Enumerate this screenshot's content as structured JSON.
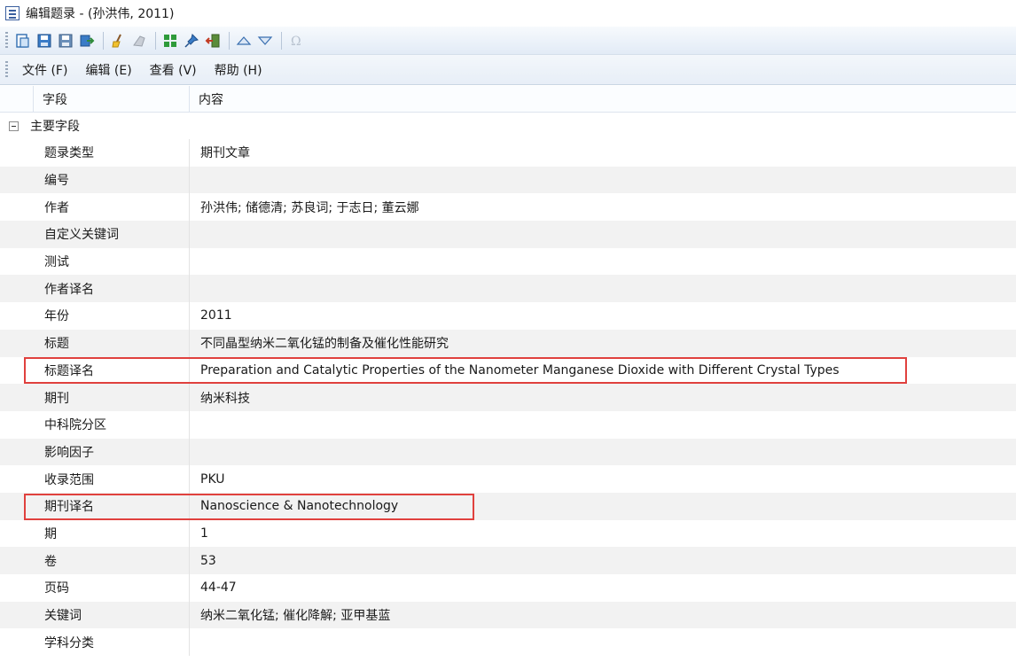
{
  "window": {
    "title": "编辑题录 - (孙洪伟, 2011)"
  },
  "toolbar": {
    "icons": [
      "new-record-icon",
      "save-icon",
      "save-as-icon",
      "export-icon",
      "clean-icon",
      "tag-icon",
      "grid-icon",
      "pin-icon",
      "exit-icon",
      "up-arrow-icon",
      "down-arrow-icon",
      "omega-icon"
    ]
  },
  "menu": {
    "file": "文件 (F)",
    "edit": "编辑 (E)",
    "view": "查看 (V)",
    "help": "帮助 (H)"
  },
  "grid": {
    "header": {
      "field": "字段",
      "content": "内容"
    },
    "group": "主要字段",
    "rows": [
      {
        "field": "题录类型",
        "content": "期刊文章"
      },
      {
        "field": "编号",
        "content": ""
      },
      {
        "field": "作者",
        "content": "孙洪伟; 储德清; 苏良词; 于志日; 董云娜"
      },
      {
        "field": "自定义关键词",
        "content": ""
      },
      {
        "field": "测试",
        "content": ""
      },
      {
        "field": "作者译名",
        "content": ""
      },
      {
        "field": "年份",
        "content": "2011"
      },
      {
        "field": "标题",
        "content": "不同晶型纳米二氧化锰的制备及催化性能研究"
      },
      {
        "field": "标题译名",
        "content": "Preparation and Catalytic Properties of the Nanometer Manganese Dioxide with Different Crystal Types"
      },
      {
        "field": "期刊",
        "content": "纳米科技"
      },
      {
        "field": "中科院分区",
        "content": ""
      },
      {
        "field": "影响因子",
        "content": ""
      },
      {
        "field": "收录范围",
        "content": "PKU"
      },
      {
        "field": "期刊译名",
        "content": "Nanoscience & Nanotechnology"
      },
      {
        "field": "期",
        "content": "1"
      },
      {
        "field": "卷",
        "content": "53"
      },
      {
        "field": "页码",
        "content": "44-47"
      },
      {
        "field": "关键词",
        "content": "纳米二氧化锰; 催化降解; 亚甲基蓝"
      },
      {
        "field": "学科分类",
        "content": ""
      }
    ]
  },
  "colors": {
    "highlight": "#e0413e",
    "toolbar_top": "#f7fafd",
    "toolbar_bottom": "#e2ebf6",
    "alt_row": "#f2f2f2"
  }
}
